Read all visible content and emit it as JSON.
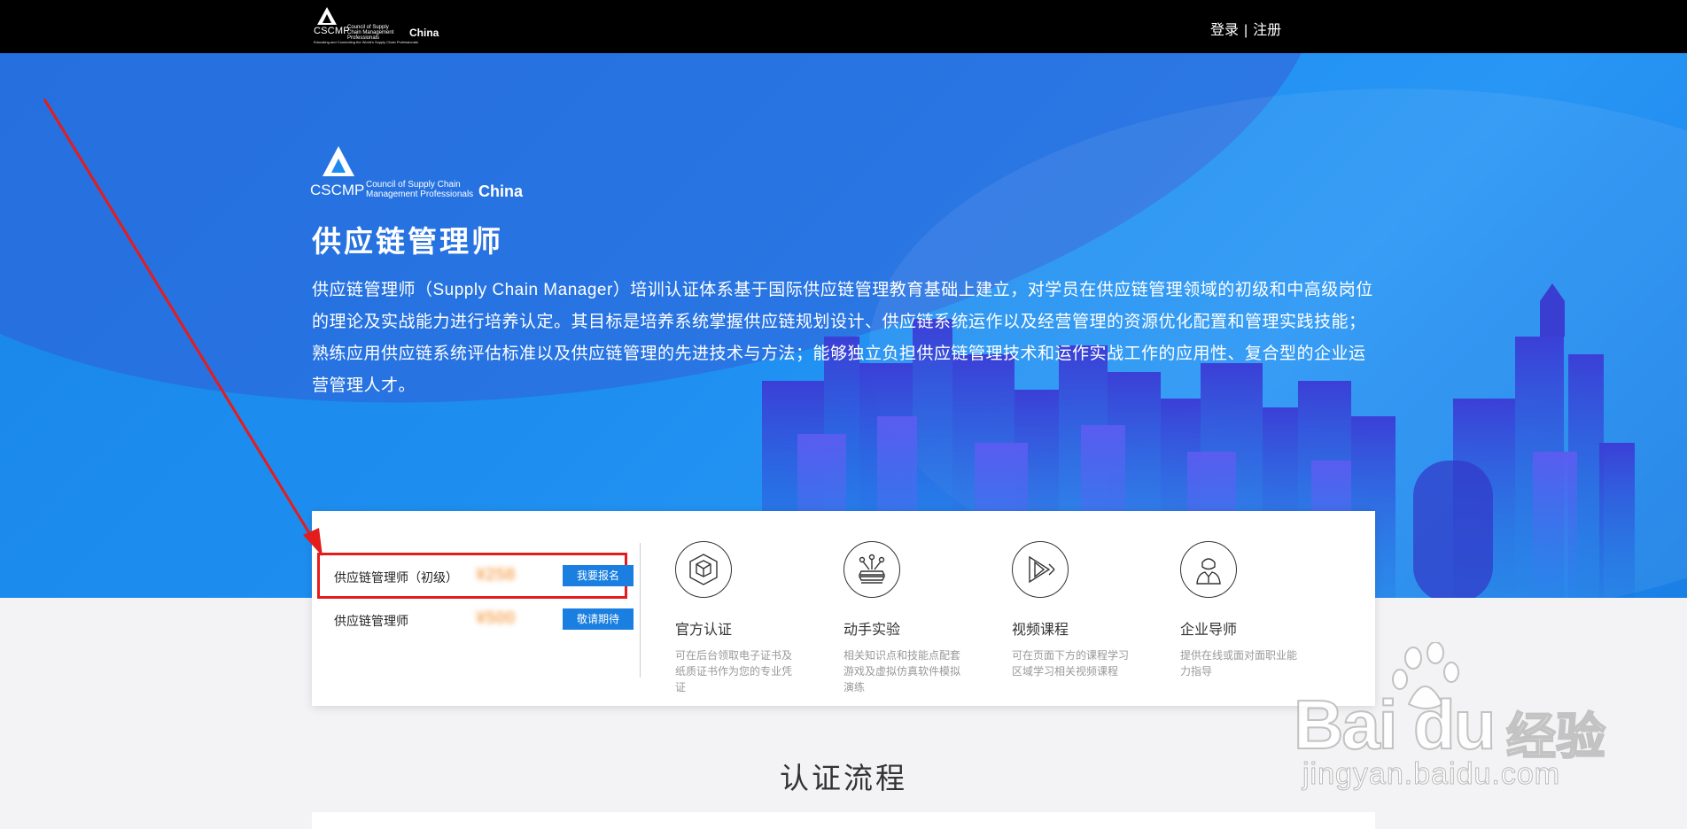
{
  "topbar": {
    "logo": {
      "abbr": "CSCMP",
      "council": "Council of Supply Chain Management Professionals",
      "region": "China",
      "motto": "Educating and Connecting the World's Supply Chain Professionals"
    },
    "login_label": "登录",
    "separator": "|",
    "register_label": "注册"
  },
  "hero": {
    "logo": {
      "abbr": "CSCMP",
      "council_line1": "Council of Supply Chain",
      "council_line2": "Management Professionals",
      "region": "China"
    },
    "title": "供应链管理师",
    "description": "供应链管理师（Supply Chain Manager）培训认证体系基于国际供应链管理教育基础上建立，对学员在供应链管理领域的初级和中高级岗位的理论及实战能力进行培养认定。其目标是培养系统掌握供应链规划设计、供应链系统运作以及经营管理的资源优化配置和管理实践技能；熟练应用供应链系统评估标准以及供应链管理的先进技术与方法；能够独立负担供应链管理技术和运作实战工作的应用性、复合型的企业运营管理人才。"
  },
  "courses": [
    {
      "name": "供应链管理师（初级）",
      "price": "¥258",
      "button": "我要报名"
    },
    {
      "name": "供应链管理师",
      "price": "¥500",
      "button": "敬请期待"
    }
  ],
  "features": [
    {
      "icon": "cube-certificate-icon",
      "title": "官方认证",
      "desc": "可在后台领取电子证书及纸质证书作为您的专业凭证"
    },
    {
      "icon": "experiment-network-icon",
      "title": "动手实验",
      "desc": "相关知识点和技能点配套游戏及虚拟仿真软件模拟演练"
    },
    {
      "icon": "video-play-icon",
      "title": "视频课程",
      "desc": "可在页面下方的课程学习区域学习相关视频课程"
    },
    {
      "icon": "mentor-person-icon",
      "title": "企业导师",
      "desc": "提供在线或面对面职业能力指导"
    }
  ],
  "process": {
    "title": "认证流程"
  },
  "watermark": {
    "brand": "Bai du",
    "brand_cn": "经验",
    "url": "jingyan.baidu.com"
  },
  "colors": {
    "topbar": "#000000",
    "hero": "#1d8ef0",
    "button": "#1a7fe0",
    "highlight": "#e51c1c",
    "price": "#f7b06a"
  }
}
